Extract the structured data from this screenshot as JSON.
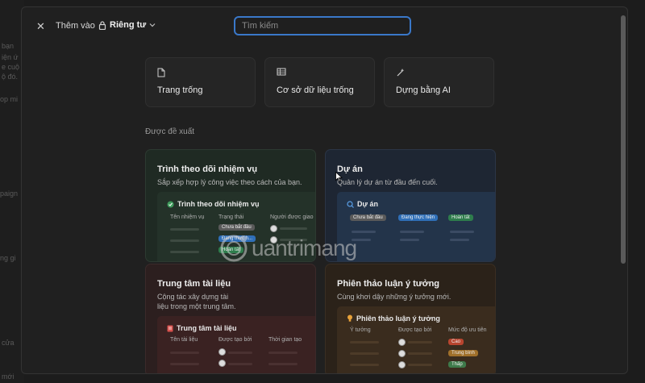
{
  "background": {
    "fragments": [
      "bạn",
      "iện ứ",
      "e cuộ",
      "ộ đó.",
      "op mi",
      "paign",
      "ng gi",
      "cửa",
      "mới"
    ]
  },
  "header": {
    "close_icon": "close-icon",
    "add_to_label": "Thêm vào",
    "privacy_icon": "lock-icon",
    "privacy_label": "Riêng tư",
    "dropdown_icon": "chevron-down-icon"
  },
  "search": {
    "placeholder": "Tìm kiếm",
    "value": ""
  },
  "quick_actions": [
    {
      "icon": "page-icon",
      "label": "Trang trống"
    },
    {
      "icon": "database-icon",
      "label": "Cơ sở dữ liệu trống"
    },
    {
      "icon": "ai-build-icon",
      "label": "Dựng bằng AI"
    }
  ],
  "suggested": {
    "heading": "Được đề xuất",
    "templates": [
      {
        "title": "Trình theo dõi nhiệm vụ",
        "description": "Sắp xếp hợp lý công việc theo cách của bạn.",
        "preview": {
          "title": "Trình theo dõi nhiệm vụ",
          "columns": [
            "Tên nhiệm vụ",
            "Trạng thái",
            "Người được giao"
          ],
          "statuses": [
            "Chưa bắt đầu",
            "Đang thực h...",
            "Hoàn tất"
          ]
        }
      },
      {
        "title": "Dự án",
        "description": "Quản lý dự án từ đầu đến cuối.",
        "preview": {
          "title": "Dự án",
          "statuses": [
            "Chưa bắt đầu",
            "Đang thực hiện",
            "Hoàn tất"
          ]
        }
      },
      {
        "title": "Trung tâm tài liệu",
        "description": "Cộng tác xây dựng tài liệu trong một trung tâm.",
        "preview": {
          "title": "Trung tâm tài liệu",
          "columns": [
            "Tên tài liệu",
            "Được tạo bởi",
            "Thời gian tạo"
          ]
        }
      },
      {
        "title": "Phiên thảo luận ý tưởng",
        "description": "Cùng khơi dậy những ý tưởng mới.",
        "preview": {
          "title": "Phiên thảo luận ý tưởng",
          "columns": [
            "Ý tưởng",
            "Được tạo bởi",
            "Mức độ ưu tiên"
          ],
          "priorities": [
            "Cao",
            "Trung bình",
            "Thấp"
          ]
        }
      }
    ]
  },
  "watermark": {
    "text": "uantrimang"
  },
  "colors": {
    "accent": "#3a78c9",
    "card_green": "#1f2a23",
    "card_blue": "#1e2633",
    "card_red": "#2c1f1f",
    "card_orange": "#2b2219"
  }
}
